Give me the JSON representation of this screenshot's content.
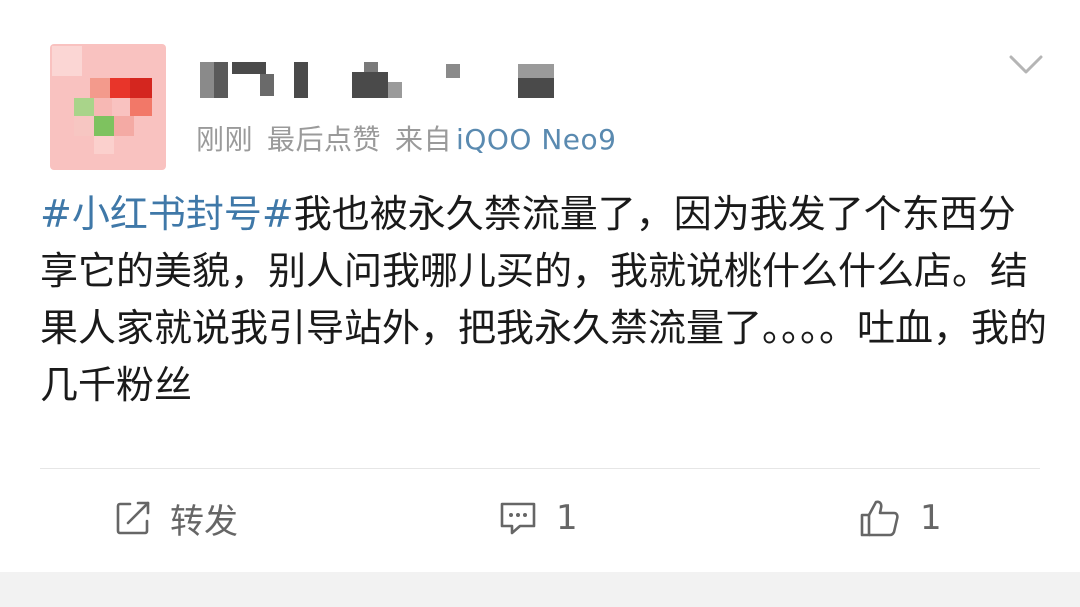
{
  "post": {
    "meta": {
      "time": "刚刚",
      "like_status": "最后点赞",
      "source_prefix": "来自",
      "device": "iQOO Neo9"
    },
    "content": {
      "hashtag": "#小红书封号#",
      "body": "我也被永久禁流量了，因为我发了个东西分享它的美貌，别人问我哪儿买的，我就说桃什么什么店。结果人家就说我引导站外，把我永久禁流量了。。。。吐血，我的几千粉丝"
    },
    "actions": {
      "repost_label": "转发",
      "comment_count": "1",
      "like_count": "1"
    }
  },
  "icons": {
    "more": "chevron-down-icon",
    "repost": "repost-icon",
    "comment": "comment-icon",
    "like": "thumbs-up-icon"
  },
  "colors": {
    "hashtag": "#3f78a8",
    "device_link": "#5a8ab0",
    "meta_text": "#9a9a9a"
  }
}
